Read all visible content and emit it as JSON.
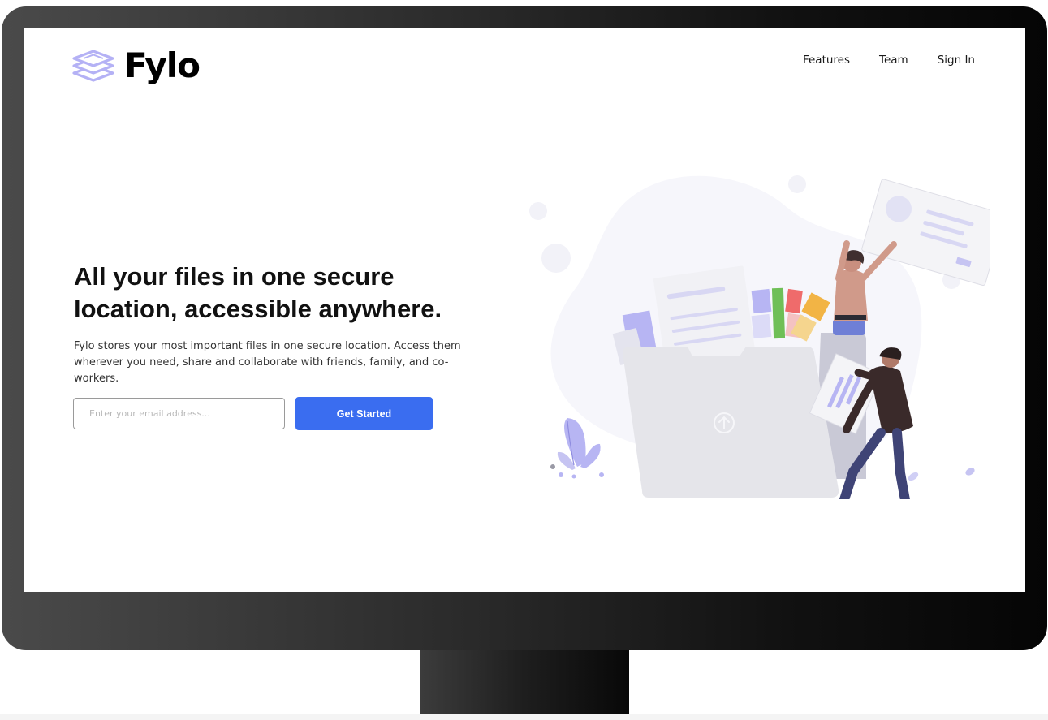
{
  "brand": {
    "name": "Fylo",
    "logo_icon": "stacked-layers-icon",
    "accent": "#3a6df0",
    "logo_color": "#b4b1f5"
  },
  "nav": [
    {
      "label": "Features"
    },
    {
      "label": "Team"
    },
    {
      "label": "Sign In"
    }
  ],
  "hero": {
    "headline": "All your files in one secure location, accessible anywhere.",
    "description": "Fylo stores your most important files in one secure location. Access them wherever you need, share and collaborate with friends, family, and co-workers.",
    "email_placeholder": "Enter your email address...",
    "cta_label": "Get Started",
    "illustration_icon": "file-upload-illustration"
  }
}
